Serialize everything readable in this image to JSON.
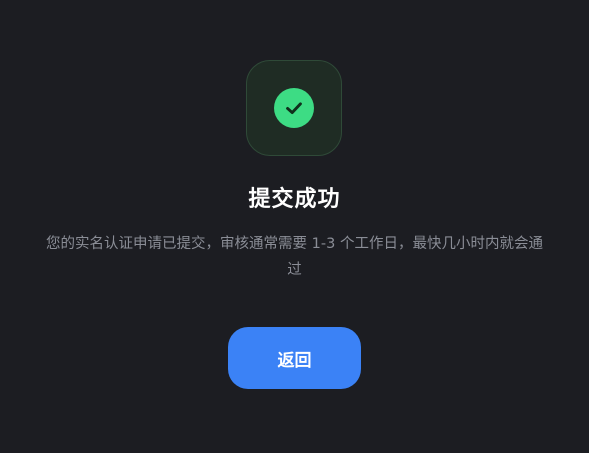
{
  "status": {
    "title": "提交成功",
    "message": "您的实名认证申请已提交，审核通常需要 1-3 个工作日，最快几小时内就会通过",
    "icon": "check-circle-icon"
  },
  "actions": {
    "back_label": "返回"
  },
  "colors": {
    "background": "#1c1d22",
    "success_green": "#3ddc84",
    "button_blue": "#3b82f6"
  }
}
